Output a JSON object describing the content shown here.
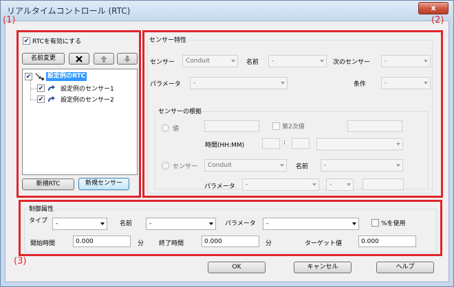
{
  "window": {
    "title": "リアルタイムコントロール (RTC)",
    "close_glyph": "x"
  },
  "markers": {
    "m1": "(1)",
    "m2": "(2)",
    "m3": "(3)"
  },
  "left": {
    "enable_label": "RTCを有効にする",
    "rename": "名前変更",
    "tree_root": "設定例のRTC",
    "tree_children": [
      "設定例のセンサー1",
      "設定例のセンサー2"
    ],
    "new_rtc": "新規RTC",
    "new_sensor": "新規センサー"
  },
  "sensor": {
    "group": "センサー特性",
    "sensor_label": "センサー",
    "sensor_value": "Conduit",
    "name_label": "名前",
    "name_value": "-",
    "next_label": "次のセンサー",
    "next_value": "-",
    "param_label": "パラメータ",
    "param_value": "-",
    "cond_label": "条件",
    "cond_value": "-",
    "basis": {
      "group": "センサーの根拠",
      "value_label": "値",
      "second_label": "第2次値",
      "time_label": "時間(HH:MM)",
      "colon": ":",
      "sensor_label": "センサー",
      "sensor_value": "Conduit",
      "name_label": "名前",
      "name_value": "-",
      "param_label": "パラメータ",
      "param_value": "-",
      "op_value": "-"
    }
  },
  "control": {
    "group": "制御属性",
    "type_label": "タイプ",
    "type_value": "-",
    "name_label": "名前",
    "name_value": "-",
    "param_label": "パラメータ",
    "param_value": "-",
    "pct_label": "%を使用",
    "start_label": "開始時間",
    "start_value": "0.000",
    "start_unit": "分",
    "end_label": "終了時間",
    "end_value": "0.000",
    "end_unit": "分",
    "target_label": "ターゲット値",
    "target_value": "0.000"
  },
  "footer": {
    "ok": "OK",
    "cancel": "キャンセル",
    "help": "ヘルプ"
  },
  "colors": {
    "marker_red": "#e0242b",
    "selection_blue": "#3399ff"
  }
}
